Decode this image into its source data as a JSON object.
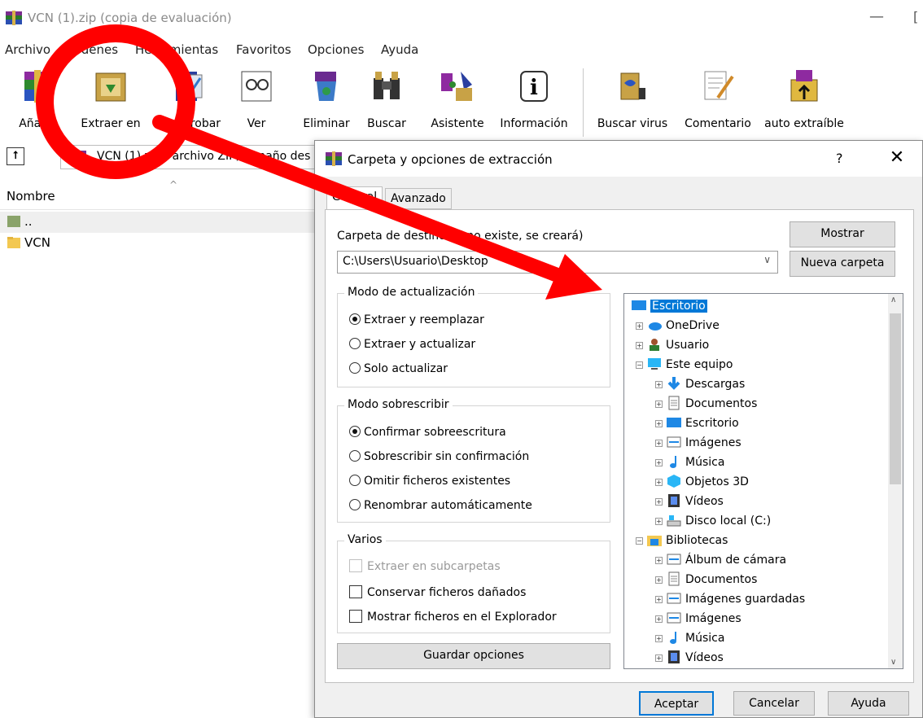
{
  "window": {
    "title": "VCN (1).zip (copia de evaluación)",
    "minimize": "—",
    "maximize": "["
  },
  "menu": [
    "Archivo",
    "Órdenes",
    "Herramientas",
    "Favoritos",
    "Opciones",
    "Ayuda"
  ],
  "toolbar": {
    "add": "Añadir",
    "extract": "Extraer en",
    "test": "Comprobar",
    "view": "Ver",
    "delete": "Eliminar",
    "find": "Buscar",
    "wizard": "Asistente",
    "info": "Información",
    "virus": "Buscar virus",
    "comment": "Comentario",
    "sfx": "auto extraíble"
  },
  "address": {
    "up": "⭡",
    "path": "VCN (1).zip - archivo ZIP, tamaño des"
  },
  "list": {
    "column_name": "Nombre",
    "sort_indicator": "^",
    "rows": [
      "..",
      "VCN"
    ]
  },
  "dialog": {
    "title": "Carpeta y opciones de extracción",
    "help": "?",
    "close": "✕",
    "tabs": [
      "General",
      "Avanzado"
    ],
    "dest_label": "Carpeta de destino (si no existe, se creará)",
    "dest_value": "C:\\Users\\Usuario\\Desktop",
    "show_button": "Mostrar",
    "new_folder_button": "Nueva carpeta",
    "update_mode": {
      "label": "Modo de actualización",
      "options": [
        "Extraer y reemplazar",
        "Extraer y actualizar",
        "Solo actualizar"
      ],
      "selected": 0
    },
    "overwrite_mode": {
      "label": "Modo sobrescribir",
      "options": [
        "Confirmar sobreescritura",
        "Sobrescribir sin confirmación",
        "Omitir ficheros existentes",
        "Renombrar automáticamente"
      ],
      "selected": 0
    },
    "misc": {
      "label": "Varios",
      "options": [
        "Extraer en subcarpetas",
        "Conservar ficheros dañados",
        "Mostrar ficheros en el Explorador"
      ]
    },
    "save_button": "Guardar opciones",
    "tree": [
      "Escritorio",
      "OneDrive",
      "Usuario",
      "Este equipo",
      "Descargas",
      "Documentos",
      "Escritorio",
      "Imágenes",
      "Música",
      "Objetos 3D",
      "Vídeos",
      "Disco local (C:)",
      "Bibliotecas",
      "Álbum de cámara",
      "Documentos",
      "Imágenes guardadas",
      "Imágenes",
      "Música",
      "Vídeos"
    ],
    "ok": "Aceptar",
    "cancel": "Cancelar",
    "help_button": "Ayuda"
  },
  "colors": {
    "annotation": "#ff0000",
    "selection": "#0078d7"
  }
}
